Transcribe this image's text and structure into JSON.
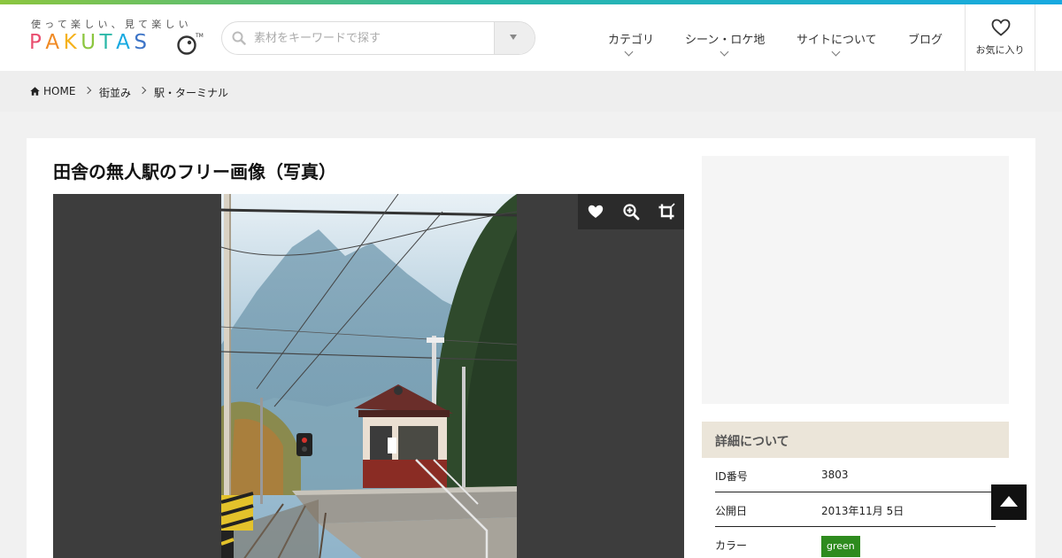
{
  "logo": {
    "tagline": "使って楽しい、見て楽しい",
    "letters": [
      {
        "char": "P",
        "color": "#e94e6f"
      },
      {
        "char": "A",
        "color": "#f08a24"
      },
      {
        "char": "K",
        "color": "#f5b21b"
      },
      {
        "char": "U",
        "color": "#8cc63f"
      },
      {
        "char": "T",
        "color": "#2bb8a8"
      },
      {
        "char": "A",
        "color": "#17a9e1"
      },
      {
        "char": "S",
        "color": "#3d74c7"
      }
    ],
    "tm": "TM"
  },
  "search": {
    "placeholder": "素材をキーワードで探す",
    "value": ""
  },
  "nav": {
    "items": [
      {
        "label": "カテゴリ",
        "has_dropdown": true
      },
      {
        "label": "シーン・ロケ地",
        "has_dropdown": true
      },
      {
        "label": "サイトについて",
        "has_dropdown": true
      },
      {
        "label": "ブログ",
        "has_dropdown": false
      }
    ],
    "favorite_label": "お気に入り"
  },
  "breadcrumb": {
    "items": [
      "HOME",
      "街並み",
      "駅・ターミナル"
    ]
  },
  "main": {
    "title": "田舎の無人駅のフリー画像（写真）"
  },
  "details": {
    "heading": "詳細について",
    "rows": [
      {
        "key": "ID番号",
        "value": "3803"
      },
      {
        "key": "公開日",
        "value": "2013年11月 5日"
      },
      {
        "key": "カラー",
        "value": "green"
      }
    ],
    "color_tag_bg": "#2e8b1e"
  },
  "icons": {
    "search": "search-icon",
    "favorite": "heart-icon",
    "home": "home-icon",
    "zoom": "zoom-in-icon",
    "crop": "crop-icon",
    "to_top": "arrow-up-icon"
  }
}
